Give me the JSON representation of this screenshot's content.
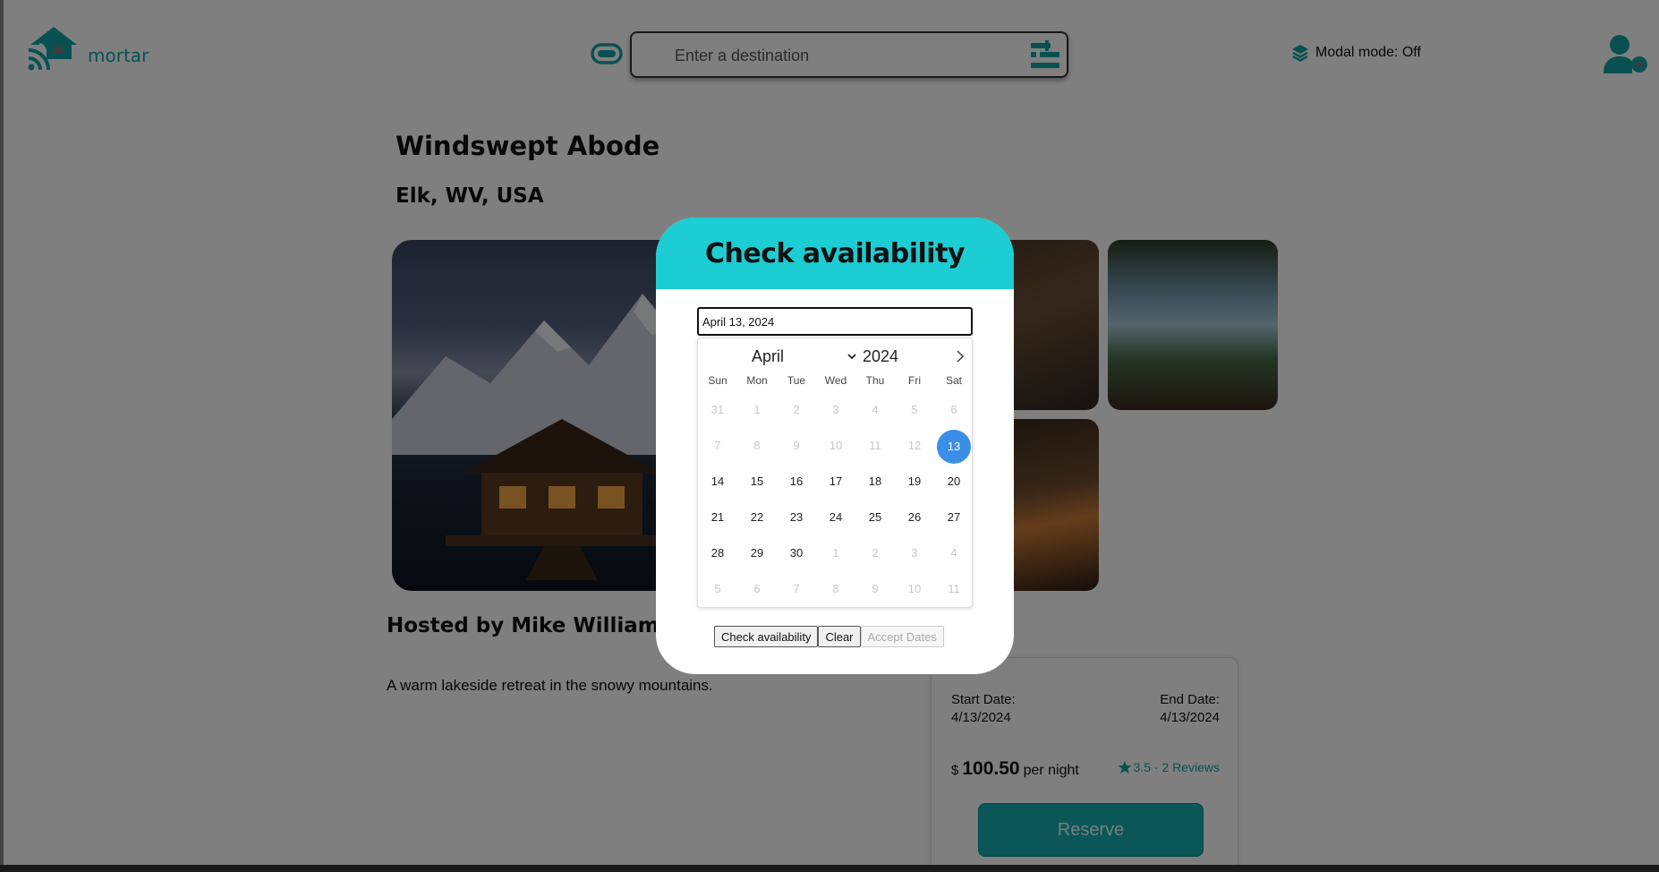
{
  "header": {
    "logo_text": "mortar",
    "search_placeholder": "Enter a destination",
    "modal_mode": "Modal mode: Off"
  },
  "listing": {
    "title": "Windswept Abode",
    "location": "Elk, WV, USA",
    "host": "Hosted by Mike Williams",
    "description": "A warm lakeside retreat in the snowy mountains."
  },
  "booking": {
    "start_label": "Start Date:",
    "start_value": "4/13/2024",
    "end_label": "End Date:",
    "end_value": "4/13/2024",
    "currency": "$",
    "price": "100.50",
    "per_night": "per night",
    "rating": "3.5 · 2 Reviews",
    "reserve_label": "Reserve"
  },
  "modal": {
    "title": "Check availability",
    "date_value": "April 13, 2024",
    "calendar": {
      "month": "April",
      "year": "2024",
      "days_of_week": [
        "Sun",
        "Mon",
        "Tue",
        "Wed",
        "Thu",
        "Fri",
        "Sat"
      ],
      "weeks": [
        [
          {
            "d": "31",
            "m": true
          },
          {
            "d": "1",
            "m": true
          },
          {
            "d": "2",
            "m": true
          },
          {
            "d": "3",
            "m": true
          },
          {
            "d": "4",
            "m": true
          },
          {
            "d": "5",
            "m": true
          },
          {
            "d": "6",
            "m": true
          }
        ],
        [
          {
            "d": "7",
            "m": true
          },
          {
            "d": "8",
            "m": true
          },
          {
            "d": "9",
            "m": true
          },
          {
            "d": "10",
            "m": true
          },
          {
            "d": "11",
            "m": true
          },
          {
            "d": "12",
            "m": true
          },
          {
            "d": "13",
            "s": true
          }
        ],
        [
          {
            "d": "14"
          },
          {
            "d": "15"
          },
          {
            "d": "16"
          },
          {
            "d": "17"
          },
          {
            "d": "18"
          },
          {
            "d": "19"
          },
          {
            "d": "20"
          }
        ],
        [
          {
            "d": "21"
          },
          {
            "d": "22"
          },
          {
            "d": "23"
          },
          {
            "d": "24"
          },
          {
            "d": "25"
          },
          {
            "d": "26"
          },
          {
            "d": "27"
          }
        ],
        [
          {
            "d": "28"
          },
          {
            "d": "29"
          },
          {
            "d": "30"
          },
          {
            "d": "1",
            "m": true
          },
          {
            "d": "2",
            "m": true
          },
          {
            "d": "3",
            "m": true
          },
          {
            "d": "4",
            "m": true
          }
        ],
        [
          {
            "d": "5",
            "m": true
          },
          {
            "d": "6",
            "m": true
          },
          {
            "d": "7",
            "m": true
          },
          {
            "d": "8",
            "m": true
          },
          {
            "d": "9",
            "m": true
          },
          {
            "d": "10",
            "m": true
          },
          {
            "d": "11",
            "m": true
          }
        ]
      ]
    },
    "buttons": {
      "check": "Check availability",
      "clear": "Clear",
      "accept": "Accept Dates"
    }
  },
  "colors": {
    "accent": "#13a3a3",
    "modal_header": "#1ccdd3",
    "selected_day": "#3a8ee6",
    "reserve_button": "#16aeae"
  },
  "icons": [
    "house-wifi-icon",
    "toggle-icon",
    "filter-icon",
    "layers-icon",
    "user-gear-icon",
    "star-icon",
    "chevron-down-icon",
    "chevron-right-icon"
  ]
}
